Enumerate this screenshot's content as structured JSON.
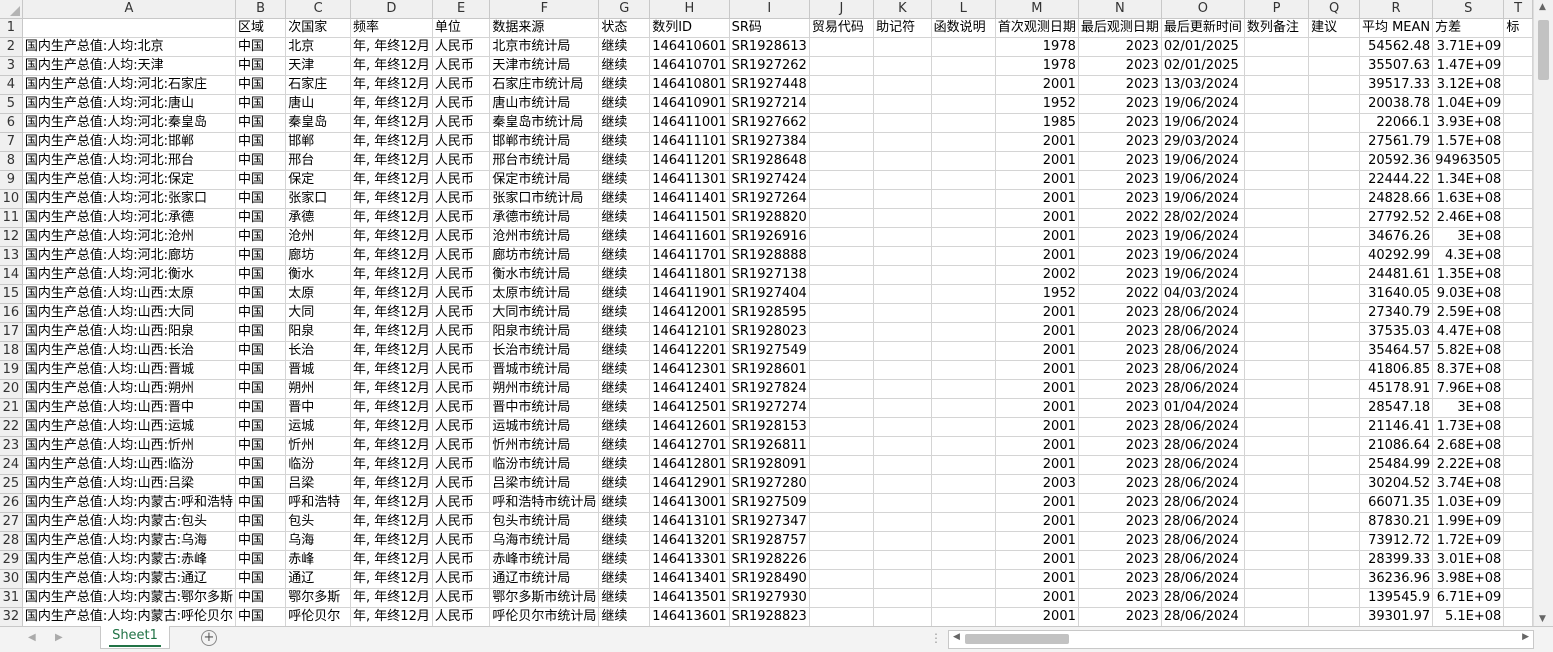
{
  "columns": [
    "A",
    "B",
    "C",
    "D",
    "E",
    "F",
    "G",
    "H",
    "I",
    "J",
    "K",
    "L",
    "M",
    "N",
    "O",
    "P",
    "Q",
    "R",
    "S",
    "T"
  ],
  "header_row": {
    "num": "1",
    "cells": [
      "",
      "区域",
      "次国家",
      "频率",
      "单位",
      "数据来源",
      "状态",
      "数列ID",
      "SR码",
      "贸易代码",
      "助记符",
      "函数说明",
      "首次观测日期",
      "最后观测日期",
      "最后更新时间",
      "数列备注",
      "建议",
      "平均 MEAN",
      "方差",
      "标"
    ]
  },
  "rows": [
    {
      "num": "2",
      "a": "国内生产总值:人均:北京",
      "city": "北京",
      "src": "北京市统计局",
      "id": "146410601",
      "sr": "SR1928613",
      "first": "1978",
      "last": "2023",
      "upd": "02/01/2025",
      "mean": "54562.48",
      "var": "3.71E+09"
    },
    {
      "num": "3",
      "a": "国内生产总值:人均:天津",
      "city": "天津",
      "src": "天津市统计局",
      "id": "146410701",
      "sr": "SR1927262",
      "first": "1978",
      "last": "2023",
      "upd": "02/01/2025",
      "mean": "35507.63",
      "var": "1.47E+09"
    },
    {
      "num": "4",
      "a": "国内生产总值:人均:河北:石家庄",
      "city": "石家庄",
      "src": "石家庄市统计局",
      "id": "146410801",
      "sr": "SR1927448",
      "first": "2001",
      "last": "2023",
      "upd": "13/03/2024",
      "mean": "39517.33",
      "var": "3.12E+08"
    },
    {
      "num": "5",
      "a": "国内生产总值:人均:河北:唐山",
      "city": "唐山",
      "src": "唐山市统计局",
      "id": "146410901",
      "sr": "SR1927214",
      "first": "1952",
      "last": "2023",
      "upd": "19/06/2024",
      "mean": "20038.78",
      "var": "1.04E+09"
    },
    {
      "num": "6",
      "a": "国内生产总值:人均:河北:秦皇岛",
      "city": "秦皇岛",
      "src": "秦皇岛市统计局",
      "id": "146411001",
      "sr": "SR1927662",
      "first": "1985",
      "last": "2023",
      "upd": "19/06/2024",
      "mean": "22066.1",
      "var": "3.93E+08"
    },
    {
      "num": "7",
      "a": "国内生产总值:人均:河北:邯郸",
      "city": "邯郸",
      "src": "邯郸市统计局",
      "id": "146411101",
      "sr": "SR1927384",
      "first": "2001",
      "last": "2023",
      "upd": "29/03/2024",
      "mean": "27561.79",
      "var": "1.57E+08"
    },
    {
      "num": "8",
      "a": "国内生产总值:人均:河北:邢台",
      "city": "邢台",
      "src": "邢台市统计局",
      "id": "146411201",
      "sr": "SR1928648",
      "first": "2001",
      "last": "2023",
      "upd": "19/06/2024",
      "mean": "20592.36",
      "var": "94963505"
    },
    {
      "num": "9",
      "a": "国内生产总值:人均:河北:保定",
      "city": "保定",
      "src": "保定市统计局",
      "id": "146411301",
      "sr": "SR1927424",
      "first": "2001",
      "last": "2023",
      "upd": "19/06/2024",
      "mean": "22444.22",
      "var": "1.34E+08"
    },
    {
      "num": "10",
      "a": "国内生产总值:人均:河北:张家口",
      "city": "张家口",
      "src": "张家口市统计局",
      "id": "146411401",
      "sr": "SR1927264",
      "first": "2001",
      "last": "2023",
      "upd": "19/06/2024",
      "mean": "24828.66",
      "var": "1.63E+08"
    },
    {
      "num": "11",
      "a": "国内生产总值:人均:河北:承德",
      "city": "承德",
      "src": "承德市统计局",
      "id": "146411501",
      "sr": "SR1928820",
      "first": "2001",
      "last": "2022",
      "upd": "28/02/2024",
      "mean": "27792.52",
      "var": "2.46E+08"
    },
    {
      "num": "12",
      "a": "国内生产总值:人均:河北:沧州",
      "city": "沧州",
      "src": "沧州市统计局",
      "id": "146411601",
      "sr": "SR1926916",
      "first": "2001",
      "last": "2023",
      "upd": "19/06/2024",
      "mean": "34676.26",
      "var": "3E+08"
    },
    {
      "num": "13",
      "a": "国内生产总值:人均:河北:廊坊",
      "city": "廊坊",
      "src": "廊坊市统计局",
      "id": "146411701",
      "sr": "SR1928888",
      "first": "2001",
      "last": "2023",
      "upd": "19/06/2024",
      "mean": "40292.99",
      "var": "4.3E+08"
    },
    {
      "num": "14",
      "a": "国内生产总值:人均:河北:衡水",
      "city": "衡水",
      "src": "衡水市统计局",
      "id": "146411801",
      "sr": "SR1927138",
      "first": "2002",
      "last": "2023",
      "upd": "19/06/2024",
      "mean": "24481.61",
      "var": "1.35E+08"
    },
    {
      "num": "15",
      "a": "国内生产总值:人均:山西:太原",
      "city": "太原",
      "src": "太原市统计局",
      "id": "146411901",
      "sr": "SR1927404",
      "first": "1952",
      "last": "2022",
      "upd": "04/03/2024",
      "mean": "31640.05",
      "var": "9.03E+08"
    },
    {
      "num": "16",
      "a": "国内生产总值:人均:山西:大同",
      "city": "大同",
      "src": "大同市统计局",
      "id": "146412001",
      "sr": "SR1928595",
      "first": "2001",
      "last": "2023",
      "upd": "28/06/2024",
      "mean": "27340.79",
      "var": "2.59E+08"
    },
    {
      "num": "17",
      "a": "国内生产总值:人均:山西:阳泉",
      "city": "阳泉",
      "src": "阳泉市统计局",
      "id": "146412101",
      "sr": "SR1928023",
      "first": "2001",
      "last": "2023",
      "upd": "28/06/2024",
      "mean": "37535.03",
      "var": "4.47E+08"
    },
    {
      "num": "18",
      "a": "国内生产总值:人均:山西:长治",
      "city": "长治",
      "src": "长治市统计局",
      "id": "146412201",
      "sr": "SR1927549",
      "first": "2001",
      "last": "2023",
      "upd": "28/06/2024",
      "mean": "35464.57",
      "var": "5.82E+08"
    },
    {
      "num": "19",
      "a": "国内生产总值:人均:山西:晋城",
      "city": "晋城",
      "src": "晋城市统计局",
      "id": "146412301",
      "sr": "SR1928601",
      "first": "2001",
      "last": "2023",
      "upd": "28/06/2024",
      "mean": "41806.85",
      "var": "8.37E+08"
    },
    {
      "num": "20",
      "a": "国内生产总值:人均:山西:朔州",
      "city": "朔州",
      "src": "朔州市统计局",
      "id": "146412401",
      "sr": "SR1927824",
      "first": "2001",
      "last": "2023",
      "upd": "28/06/2024",
      "mean": "45178.91",
      "var": "7.96E+08"
    },
    {
      "num": "21",
      "a": "国内生产总值:人均:山西:晋中",
      "city": "晋中",
      "src": "晋中市统计局",
      "id": "146412501",
      "sr": "SR1927274",
      "first": "2001",
      "last": "2023",
      "upd": "01/04/2024",
      "mean": "28547.18",
      "var": "3E+08"
    },
    {
      "num": "22",
      "a": "国内生产总值:人均:山西:运城",
      "city": "运城",
      "src": "运城市统计局",
      "id": "146412601",
      "sr": "SR1928153",
      "first": "2001",
      "last": "2023",
      "upd": "28/06/2024",
      "mean": "21146.41",
      "var": "1.73E+08"
    },
    {
      "num": "23",
      "a": "国内生产总值:人均:山西:忻州",
      "city": "忻州",
      "src": "忻州市统计局",
      "id": "146412701",
      "sr": "SR1926811",
      "first": "2001",
      "last": "2023",
      "upd": "28/06/2024",
      "mean": "21086.64",
      "var": "2.68E+08"
    },
    {
      "num": "24",
      "a": "国内生产总值:人均:山西:临汾",
      "city": "临汾",
      "src": "临汾市统计局",
      "id": "146412801",
      "sr": "SR1928091",
      "first": "2001",
      "last": "2023",
      "upd": "28/06/2024",
      "mean": "25484.99",
      "var": "2.22E+08"
    },
    {
      "num": "25",
      "a": "国内生产总值:人均:山西:吕梁",
      "city": "吕梁",
      "src": "吕梁市统计局",
      "id": "146412901",
      "sr": "SR1927280",
      "first": "2003",
      "last": "2023",
      "upd": "28/06/2024",
      "mean": "30204.52",
      "var": "3.74E+08"
    },
    {
      "num": "26",
      "a": "国内生产总值:人均:内蒙古:呼和浩特",
      "city": "呼和浩特",
      "src": "呼和浩特市统计局",
      "id": "146413001",
      "sr": "SR1927509",
      "first": "2001",
      "last": "2023",
      "upd": "28/06/2024",
      "mean": "66071.35",
      "var": "1.03E+09"
    },
    {
      "num": "27",
      "a": "国内生产总值:人均:内蒙古:包头",
      "city": "包头",
      "src": "包头市统计局",
      "id": "146413101",
      "sr": "SR1927347",
      "first": "2001",
      "last": "2023",
      "upd": "28/06/2024",
      "mean": "87830.21",
      "var": "1.99E+09"
    },
    {
      "num": "28",
      "a": "国内生产总值:人均:内蒙古:乌海",
      "city": "乌海",
      "src": "乌海市统计局",
      "id": "146413201",
      "sr": "SR1928757",
      "first": "2001",
      "last": "2023",
      "upd": "28/06/2024",
      "mean": "73912.72",
      "var": "1.72E+09"
    },
    {
      "num": "29",
      "a": "国内生产总值:人均:内蒙古:赤峰",
      "city": "赤峰",
      "src": "赤峰市统计局",
      "id": "146413301",
      "sr": "SR1928226",
      "first": "2001",
      "last": "2023",
      "upd": "28/06/2024",
      "mean": "28399.33",
      "var": "3.01E+08"
    },
    {
      "num": "30",
      "a": "国内生产总值:人均:内蒙古:通辽",
      "city": "通辽",
      "src": "通辽市统计局",
      "id": "146413401",
      "sr": "SR1928490",
      "first": "2001",
      "last": "2023",
      "upd": "28/06/2024",
      "mean": "36236.96",
      "var": "3.98E+08"
    },
    {
      "num": "31",
      "a": "国内生产总值:人均:内蒙古:鄂尔多斯",
      "city": "鄂尔多斯",
      "src": "鄂尔多斯市统计局",
      "id": "146413501",
      "sr": "SR1927930",
      "first": "2001",
      "last": "2023",
      "upd": "28/06/2024",
      "mean": "139545.9",
      "var": "6.71E+09"
    },
    {
      "num": "32",
      "a": "国内生产总值:人均:内蒙古:呼伦贝尔",
      "city": "呼伦贝尔",
      "src": "呼伦贝尔市统计局",
      "id": "146413601",
      "sr": "SR1928823",
      "first": "2001",
      "last": "2023",
      "upd": "28/06/2024",
      "mean": "39301.97",
      "var": "5.1E+08"
    }
  ],
  "common": {
    "region": "中国",
    "freq": "年, 年终12月",
    "unit": "人民币",
    "status": "继续"
  },
  "sheet_tab": "Sheet1",
  "add_sheet_icon": "plus-circle-icon",
  "accent_color": "#217346"
}
